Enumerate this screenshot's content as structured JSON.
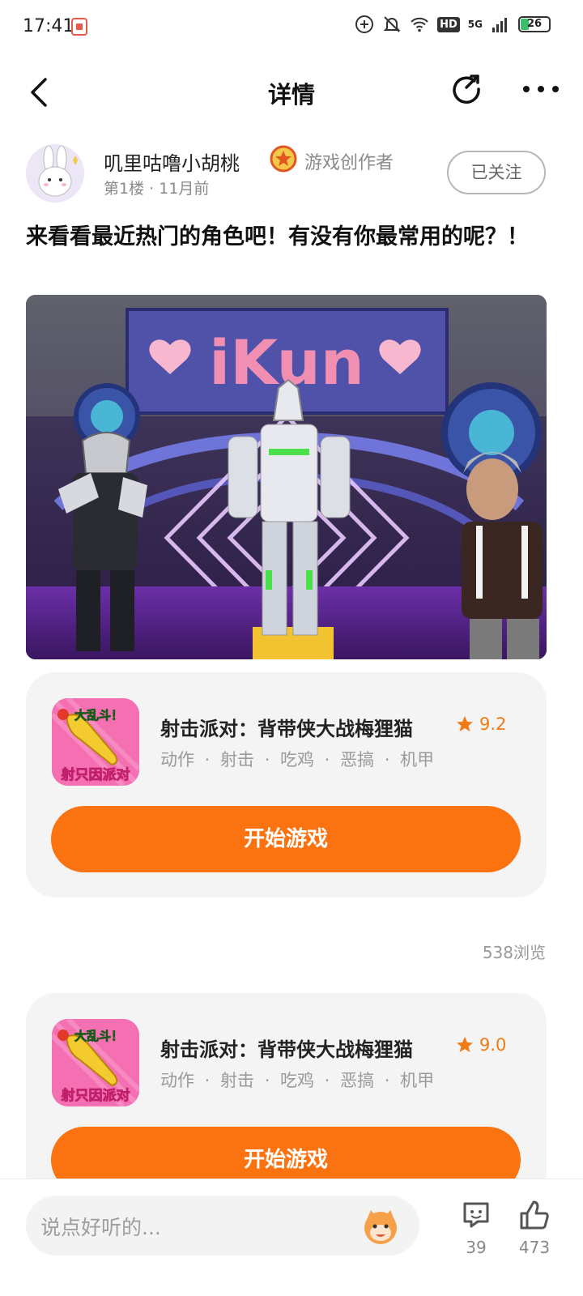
{
  "status_bar": {
    "time": "17:41",
    "hd": "HD",
    "network": "5G",
    "battery": "26"
  },
  "header": {
    "title": "详情"
  },
  "author": {
    "name": "叽里咕噜小胡桃",
    "badge": "游戏创作者",
    "floor": "第1楼",
    "time_ago": "11月前",
    "follow_label": "已关注"
  },
  "post": {
    "text": "来看看最近热门的角色吧！有没有你最常用的呢？！",
    "image_sign_text": "iKun"
  },
  "games": [
    {
      "name": "射击派对：背带侠大战梅狸猫",
      "rating": "9.2",
      "tags": "动作 · 射击 · 吃鸡 · 恶搞 · 机甲",
      "icon_top_text": "大乱斗！",
      "icon_bottom_text": "射只因派对",
      "button_label": "开始游戏"
    },
    {
      "name": "射击派对：背带侠大战梅狸猫",
      "rating": "9.0",
      "tags": "动作 · 射击 · 吃鸡 · 恶搞 · 机甲",
      "icon_top_text": "大乱斗！",
      "icon_bottom_text": "射只因派对",
      "button_label": "开始游戏"
    }
  ],
  "views": "538浏览",
  "bottom_bar": {
    "comment_placeholder": "说点好听的...",
    "comment_count": "39",
    "like_count": "473"
  },
  "colors": {
    "accent": "#fb7310",
    "rating": "#f07a14",
    "card_bg": "#f4f4f4"
  }
}
